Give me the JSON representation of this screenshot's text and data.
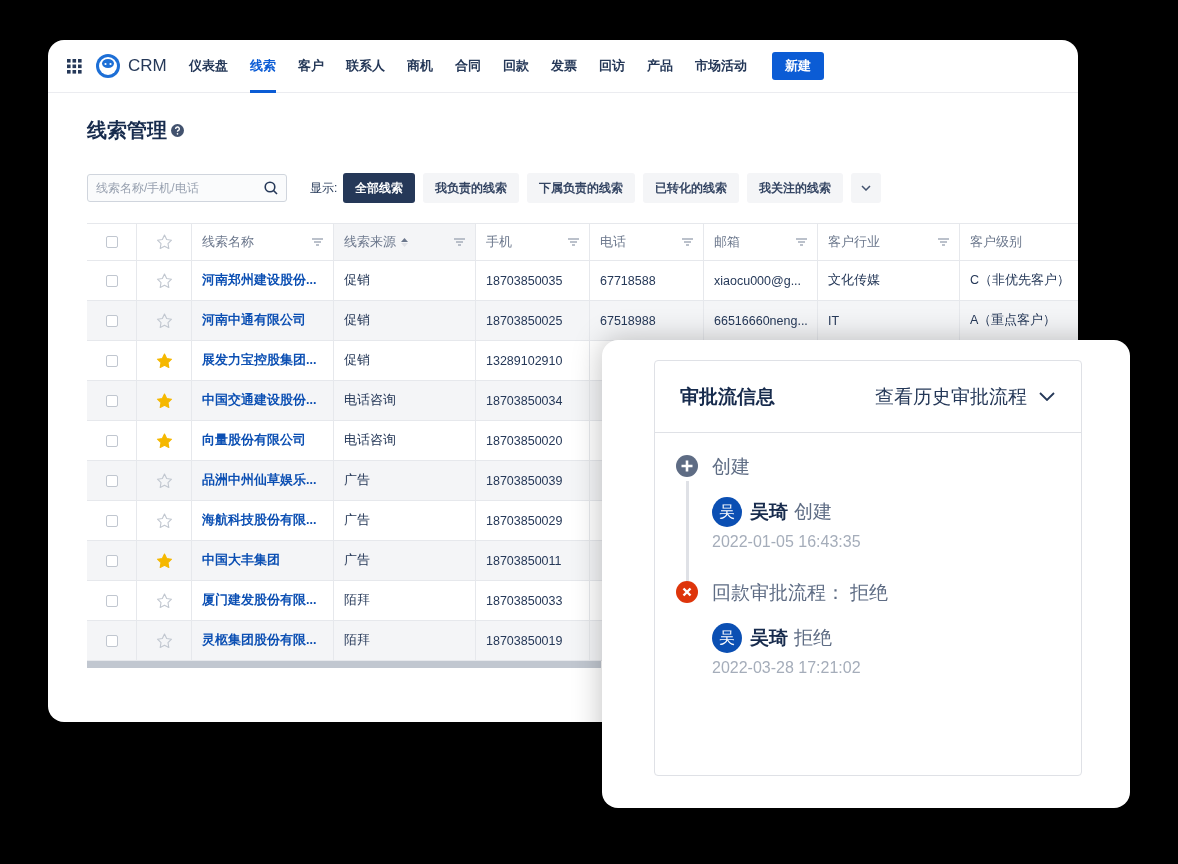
{
  "nav": {
    "brand": "CRM",
    "items": [
      {
        "label": "仪表盘",
        "selected": false
      },
      {
        "label": "线索",
        "selected": true
      },
      {
        "label": "客户",
        "selected": false
      },
      {
        "label": "联系人",
        "selected": false
      },
      {
        "label": "商机",
        "selected": false
      },
      {
        "label": "合同",
        "selected": false
      },
      {
        "label": "回款",
        "selected": false
      },
      {
        "label": "发票",
        "selected": false
      },
      {
        "label": "回访",
        "selected": false
      },
      {
        "label": "产品",
        "selected": false
      },
      {
        "label": "市场活动",
        "selected": false
      }
    ],
    "new_button": "新建"
  },
  "page_title": "线索管理",
  "search": {
    "placeholder": "线索名称/手机/电话"
  },
  "filter_label": "显示:",
  "filters": [
    {
      "label": "全部线索",
      "selected": true
    },
    {
      "label": "我负责的线索",
      "selected": false
    },
    {
      "label": "下属负责的线索",
      "selected": false
    },
    {
      "label": "已转化的线索",
      "selected": false
    },
    {
      "label": "我关注的线索",
      "selected": false
    }
  ],
  "table": {
    "all_checked": false,
    "columns": [
      {
        "label": "线索名称",
        "sorted": false
      },
      {
        "label": "线索来源",
        "sorted": true
      },
      {
        "label": "手机",
        "sorted": false
      },
      {
        "label": "电话",
        "sorted": false
      },
      {
        "label": "邮箱",
        "sorted": false
      },
      {
        "label": "客户行业",
        "sorted": false
      },
      {
        "label": "客户级别",
        "sorted": false
      }
    ],
    "rows": [
      {
        "checked": false,
        "starred": false,
        "cells": [
          "河南郑州建设股份...",
          "促销",
          "18703850035",
          "67718588",
          "xiaocu000@g...",
          "文化传媒",
          "C（非优先客户）"
        ]
      },
      {
        "checked": false,
        "starred": false,
        "cells": [
          "河南中通有限公司",
          "促销",
          "18703850025",
          "67518988",
          "66516660neng...",
          "IT",
          "A（重点客户）"
        ]
      },
      {
        "checked": false,
        "starred": true,
        "cells": [
          "展发力宝控股集团...",
          "促销",
          "13289102910"
        ]
      },
      {
        "checked": false,
        "starred": true,
        "cells": [
          "中国交通建设股份...",
          "电话咨询",
          "18703850034"
        ]
      },
      {
        "checked": false,
        "starred": true,
        "cells": [
          "向量股份有限公司",
          "电话咨询",
          "18703850020"
        ]
      },
      {
        "checked": false,
        "starred": false,
        "cells": [
          "品洲中州仙草娱乐...",
          "广告",
          "18703850039"
        ]
      },
      {
        "checked": false,
        "starred": false,
        "cells": [
          "海航科技股份有限...",
          "广告",
          "18703850029"
        ]
      },
      {
        "checked": false,
        "starred": true,
        "cells": [
          "中国大丰集团",
          "广告",
          "18703850011"
        ]
      },
      {
        "checked": false,
        "starred": false,
        "cells": [
          "厦门建发股份有限...",
          "陌拜",
          "18703850033"
        ]
      },
      {
        "checked": false,
        "starred": false,
        "cells": [
          "灵柩集团股份有限...",
          "陌拜",
          "18703850019"
        ]
      }
    ]
  },
  "approval": {
    "title": "审批流信息",
    "history_link": "查看历史审批流程",
    "steps": [
      {
        "kind": "create",
        "title": "创建",
        "avatar": "吴",
        "person": "吴琦",
        "action": "创建",
        "time": "2022-01-05 16:43:35"
      },
      {
        "kind": "reject",
        "title": "回款审批流程：  拒绝",
        "avatar": "吴",
        "person": "吴琦",
        "action": "拒绝",
        "time": "2022-03-28 17:21:02"
      }
    ]
  }
}
